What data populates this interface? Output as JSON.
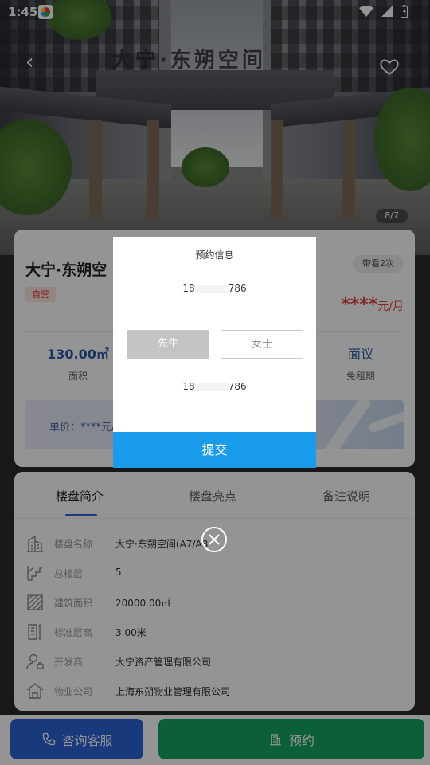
{
  "status_bar": {
    "time": "1:45"
  },
  "hero": {
    "sign_text": "大宁·东朔空间",
    "photo_counter": "8/7"
  },
  "listing": {
    "title": "大宁·东朔空",
    "viewed_badge": "带看2次",
    "self_operated_tag": "自营",
    "price_masked": "****",
    "price_unit": "元/月",
    "stats": [
      {
        "value": "130.00㎡",
        "label": "面积"
      },
      {
        "value": "面议",
        "label": "免租期"
      }
    ],
    "unit_price": "单价：****元/"
  },
  "tabs": [
    {
      "label": "楼盘简介"
    },
    {
      "label": "楼盘亮点"
    },
    {
      "label": "备注说明"
    }
  ],
  "details": [
    {
      "label": "楼盘名称",
      "value": "大宁·东朔空间(A7/A8",
      "icon": "building-icon"
    },
    {
      "label": "总楼层",
      "value": "5",
      "icon": "stairs-icon"
    },
    {
      "label": "建筑面积",
      "value": "20000.00㎡",
      "icon": "area-icon"
    },
    {
      "label": "标准层高",
      "value": "3.00米",
      "icon": "floor-height-icon"
    },
    {
      "label": "开发商",
      "value": "大宁资产管理有限公司",
      "icon": "developer-icon"
    },
    {
      "label": "物业公司",
      "value": "上海东朔物业管理有限公司",
      "icon": "property-icon"
    }
  ],
  "bottom_bar": {
    "consult_label": "咨询客服",
    "book_label": "预约"
  },
  "modal": {
    "title": "预约信息",
    "phone_prefix": "18",
    "phone_suffix": "786",
    "gender_male": "先生",
    "gender_female": "女士",
    "phone2_prefix": "18",
    "phone2_suffix": "786",
    "submit_label": "提交"
  },
  "colors": {
    "primary_blue": "#2c63d8",
    "submit_blue": "#1a9cec",
    "book_green": "#13a563",
    "price_red": "#e0463c"
  }
}
